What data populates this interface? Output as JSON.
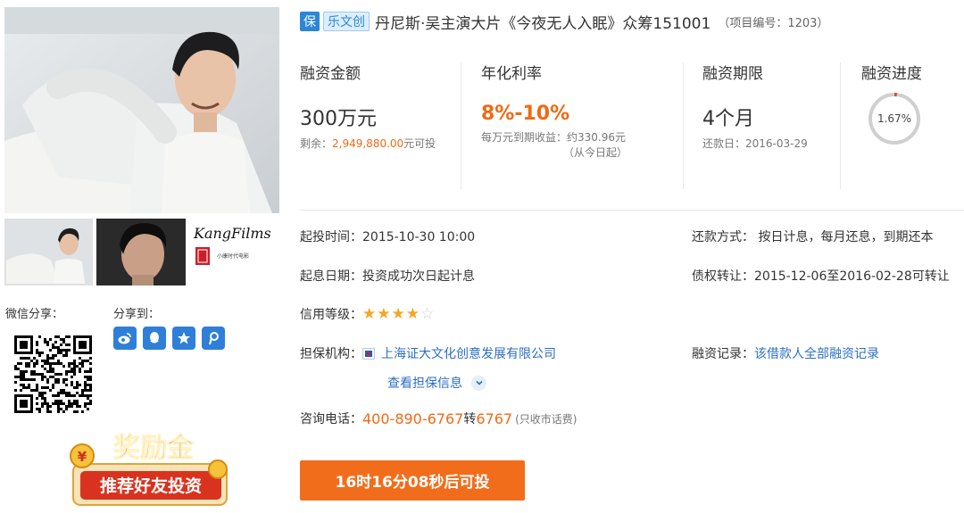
{
  "title": {
    "badge_bao": "保",
    "badge_le": "乐文创",
    "text": "丹尼斯·吴主演大片《今夜无人入眠》众筹151001",
    "project_no": "（项目编号：1203）"
  },
  "stats": {
    "amount": {
      "label": "融资金额",
      "value": "300万元",
      "note_prefix": "剩余：",
      "remaining": "2,949,880.00",
      "note_suffix": "元可投"
    },
    "rate": {
      "label": "年化利率",
      "value": "8%-10%",
      "note1": "每万元到期收益：约330.96元",
      "note2": "（从今日起）"
    },
    "term": {
      "label": "融资期限",
      "value": "4个月",
      "note": "还款日：2016-03-29"
    },
    "progress": {
      "label": "融资进度",
      "value": "1.67%",
      "fraction": 0.0167
    }
  },
  "details": {
    "start_time": "起投时间：2015-10-30 10:00",
    "repay_method": "还款方式： 按日计息，每月还息，到期还本",
    "interest_date": "起息日期：投资成功次日起计息",
    "transfer": "债权转让：2015-12-06至2016-02-28可转让",
    "credit_label": "信用等级：",
    "credit_stars": 4,
    "guarantor_label": "担保机构：",
    "guarantor_name": "上海证大文化创意发展有限公司",
    "guarantor_info": "查看担保信息",
    "record_label": "融资记录：",
    "record_link": "该借款人全部融资记录",
    "phone_label": "咨询电话：",
    "phone": "400-890-6767",
    "phone_ext_label": "转",
    "phone_ext": "6767",
    "phone_note": "(只收市话费)"
  },
  "cta": {
    "label": "16时16分08秒后可投"
  },
  "sidebar": {
    "wechat_share": "微信分享：",
    "share_to": "分享到：",
    "thumb3_brand": "KangFilms",
    "thumb3_sub": "小康时代电影",
    "reward_title": "奖励金",
    "reward_sub": "推荐好友投资",
    "share_icons": [
      "weibo-icon",
      "qq-icon",
      "qzone-icon",
      "tencent-weibo-icon"
    ]
  },
  "colors": {
    "accent": "#f26d1b",
    "link": "#2b6fc2",
    "badge": "#2b86d8"
  }
}
